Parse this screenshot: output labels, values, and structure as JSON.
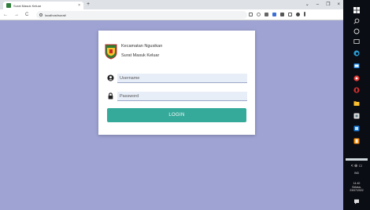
{
  "browser": {
    "tab_title": "Surat Masuk Keluar",
    "tab_close": "×",
    "new_tab": "+",
    "url": "localhost/surat/",
    "nav": {
      "back": "←",
      "forward": "→",
      "reload": "C"
    },
    "window": {
      "collapse": "⌄",
      "minimize": "–",
      "maximize": "❐",
      "close": "×"
    }
  },
  "login": {
    "org_name": "Kecamatan Ngusikan",
    "app_name": "Surat Masuk Keluar",
    "username_placeholder": "Username",
    "password_placeholder": "Password",
    "button_label": "LOGIN"
  },
  "taskbar": {
    "lang": "IND",
    "time": "14.40",
    "day": "Selasa,",
    "date": "23/07/2022"
  },
  "colors": {
    "page_bg": "#9ea3d3",
    "accent": "#35a99a",
    "card_bg": "#ffffff",
    "taskbar_bg": "#0b0d14"
  },
  "icons": [
    "user-icon",
    "lock-icon",
    "logo-emblem",
    "windows-start-icon"
  ]
}
